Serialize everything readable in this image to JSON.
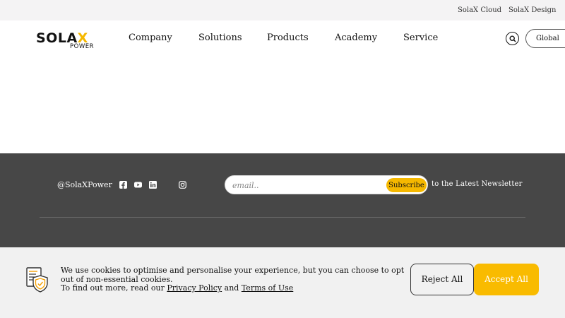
{
  "topbar": {
    "links": [
      "SolaX Cloud",
      "SolaX Design"
    ]
  },
  "header": {
    "logo_main_pre": "SOLA",
    "logo_main_x": "X",
    "logo_sub": "POWER",
    "nav": [
      "Company",
      "Solutions",
      "Products",
      "Academy",
      "Service"
    ],
    "global_label": "Global"
  },
  "footer": {
    "handle": "@SolaXPower",
    "social_icons": [
      "facebook-icon",
      "youtube-icon",
      "linkedin-icon",
      "instagram-icon"
    ],
    "email_placeholder": "email..",
    "subscribe_label": "Subscribe",
    "newsletter_text": "to the Latest Newsletter"
  },
  "cookie": {
    "text_line1": "We use cookies to optimise and personalise your experience, but you can choose to opt out of non-essential cookies.",
    "text_line2_pre": "To find out more, read our ",
    "privacy_label": "Privacy Policy",
    "and_text": " and ",
    "terms_label": "Terms of Use",
    "reject_label": "Reject All",
    "accept_label": "Accept All"
  },
  "colors": {
    "accent": "#f9bb00",
    "footer_bg": "#474747",
    "topbar_bg": "#f4f3f4",
    "cookie_bg": "#f1f1f1"
  }
}
